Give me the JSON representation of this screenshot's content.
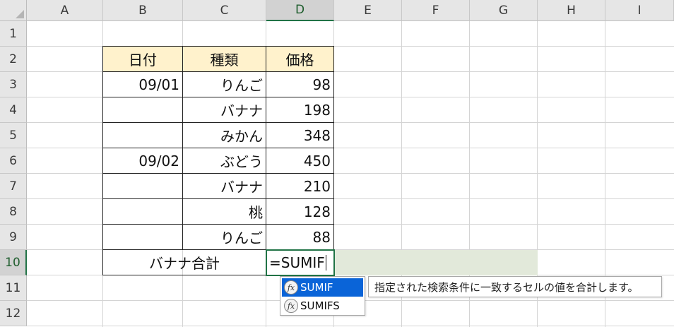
{
  "columns": [
    "A",
    "B",
    "C",
    "D",
    "E",
    "F",
    "G",
    "H",
    "I"
  ],
  "rows": [
    "1",
    "2",
    "3",
    "4",
    "5",
    "6",
    "7",
    "8",
    "9",
    "10",
    "11",
    "12"
  ],
  "table": {
    "headers": [
      "日付",
      "種類",
      "価格"
    ],
    "rows": [
      [
        "09/01",
        "りんご",
        "98"
      ],
      [
        "",
        "バナナ",
        "198"
      ],
      [
        "",
        "みかん",
        "348"
      ],
      [
        "09/02",
        "ぶどう",
        "450"
      ],
      [
        "",
        "バナナ",
        "210"
      ],
      [
        "",
        "桃",
        "128"
      ],
      [
        "",
        "りんご",
        "88"
      ]
    ],
    "total_label": "バナナ合計"
  },
  "active_cell": {
    "ref": "D10",
    "formula": "=SUMIF"
  },
  "autocomplete": {
    "icon_label": "fx",
    "items": [
      "SUMIF",
      "SUMIFS"
    ],
    "selected": "SUMIF",
    "tooltip": "指定された検索条件に一致するセルの値を合計します。"
  },
  "colors": {
    "header_fill": "#fff2cc",
    "selection_accent": "#217346",
    "selection_band": "#e2e9da",
    "autocomplete_highlight": "#0a64d8"
  }
}
